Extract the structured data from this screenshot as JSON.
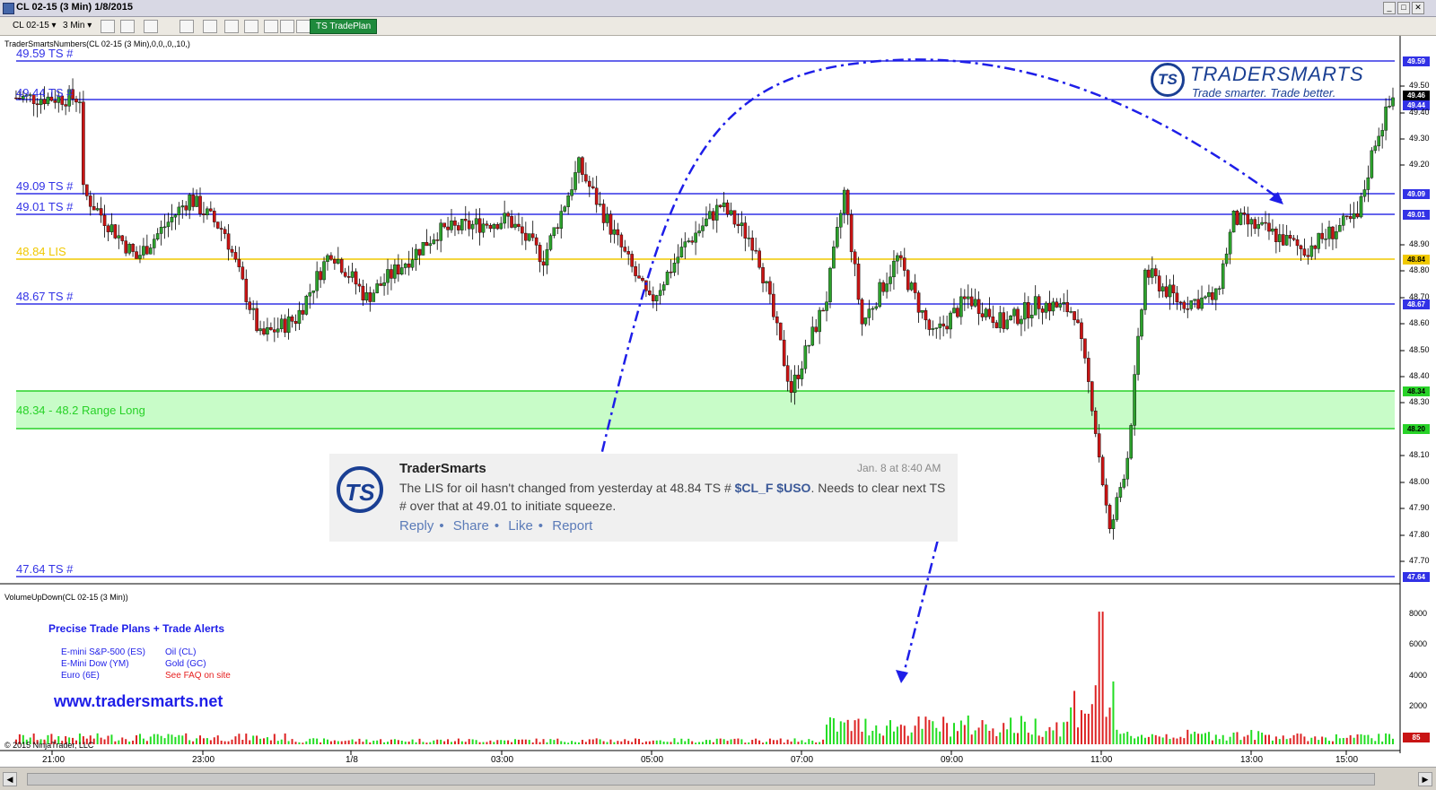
{
  "window": {
    "title": "CL 02-15 (3 Min)  1/8/2015"
  },
  "toolbar": {
    "instrument": "CL 02-15",
    "interval": "3 Min",
    "tradeplan_label": "TS TradePlan"
  },
  "indicator_label": "TraderSmartsNumbers(CL 02-15 (3 Min),0,0,,0,,10,)",
  "volume_label": "VolumeUpDown(CL 02-15 (3 Min))",
  "levels": [
    {
      "label": "49.59 TS #",
      "value": 49.59,
      "tag": "49.59",
      "color": "#3232e6"
    },
    {
      "label": "49.44 TS #",
      "value": 49.44,
      "tag": "49.44",
      "color": "#3232e6"
    },
    {
      "label": "49.09 TS #",
      "value": 49.09,
      "tag": "49.09",
      "color": "#3232e6"
    },
    {
      "label": "49.01 TS #",
      "value": 49.01,
      "tag": "49.01",
      "color": "#3232e6"
    },
    {
      "label": "48.84 LIS",
      "value": 48.84,
      "tag": "48.84",
      "color": "#f0c800"
    },
    {
      "label": "48.67 TS #",
      "value": 48.67,
      "tag": "48.67",
      "color": "#3232e6"
    },
    {
      "label": "47.64 TS #",
      "value": 47.64,
      "tag": "47.64",
      "color": "#3232e6"
    }
  ],
  "range_zone": {
    "label": "48.34 - 48.2 Range Long",
    "top": 48.34,
    "bottom": 48.2,
    "tag_top": "48.34",
    "tag_bottom": "48.20",
    "color": "#28d228"
  },
  "last_price": {
    "value": 49.46,
    "tag": "49.46"
  },
  "price_axis": {
    "ticks": [
      "49.50",
      "49.40",
      "49.30",
      "49.20",
      "48.90",
      "48.80",
      "48.70",
      "48.60",
      "48.50",
      "48.40",
      "48.30",
      "48.10",
      "48.00",
      "47.90",
      "47.80",
      "47.70"
    ]
  },
  "volume_axis": {
    "ticks": [
      "8000",
      "6000",
      "4000",
      "2000"
    ],
    "last_volume_tag": "85"
  },
  "time_axis": {
    "ticks": [
      "21:00",
      "23:00",
      "1/8",
      "03:00",
      "05:00",
      "07:00",
      "09:00",
      "11:00",
      "13:00",
      "15:00"
    ]
  },
  "logo": {
    "mark": "TS",
    "name": "TRADERSMARTS",
    "tagline": "Trade smarter. Trade better."
  },
  "post": {
    "author": "TraderSmarts",
    "avatar": "TS",
    "time": "Jan. 8 at 8:40 AM",
    "text_before": "The LIS for oil hasn't changed from yesterday at 48.84 TS # ",
    "tickers": "$CL_F $USO",
    "text_after": ". Needs to clear next TS # over that at 49.01 to initiate squeeze.",
    "actions": [
      "Reply",
      "Share",
      "Like",
      "Report"
    ]
  },
  "promo": {
    "title": "Precise Trade Plans + Trade Alerts",
    "items_left": [
      "E-mini S&P-500 (ES)",
      "E-Mini Dow (YM)",
      "Euro (6E)"
    ],
    "items_right": [
      "Oil (CL)",
      "Gold (GC)",
      "See FAQ on site"
    ],
    "faq_color": "#e62020",
    "site": "www.tradersmarts.net"
  },
  "copyright": "© 2015 NinjaTrader, LLC",
  "colors": {
    "up_candle": "#2ca02c",
    "down_candle": "#c81414",
    "annotation_arrow": "#1e1ee8"
  },
  "chart_data": {
    "type": "candlestick",
    "instrument": "CL 02-15",
    "interval": "3 Min",
    "ylim": [
      47.64,
      49.6
    ],
    "close_path": [
      [
        "21:00",
        49.1
      ],
      [
        "21:45",
        48.85
      ],
      [
        "22:30",
        49.08
      ],
      [
        "23:00",
        48.95
      ],
      [
        "23:30",
        48.55
      ],
      [
        "00:00",
        48.62
      ],
      [
        "00:30",
        48.88
      ],
      [
        "01:00",
        48.7
      ],
      [
        "02:00",
        48.95
      ],
      [
        "03:00",
        49.0
      ],
      [
        "03:30",
        48.85
      ],
      [
        "04:00",
        49.2
      ],
      [
        "05:00",
        48.68
      ],
      [
        "05:30",
        48.9
      ],
      [
        "06:00",
        49.05
      ],
      [
        "06:30",
        48.9
      ],
      [
        "07:00",
        48.35
      ],
      [
        "07:30",
        48.7
      ],
      [
        "07:45",
        49.1
      ],
      [
        "08:00",
        48.6
      ],
      [
        "08:30",
        48.85
      ],
      [
        "09:00",
        48.55
      ],
      [
        "09:30",
        48.7
      ],
      [
        "10:00",
        48.6
      ],
      [
        "10:30",
        48.68
      ],
      [
        "11:00",
        48.65
      ],
      [
        "11:15",
        48.3
      ],
      [
        "11:30",
        47.8
      ],
      [
        "11:45",
        48.1
      ],
      [
        "12:00",
        48.8
      ],
      [
        "12:30",
        48.68
      ],
      [
        "13:00",
        48.7
      ],
      [
        "13:15",
        49.0
      ],
      [
        "13:45",
        48.95
      ],
      [
        "14:15",
        48.88
      ],
      [
        "14:45",
        48.97
      ],
      [
        "15:00",
        49.0
      ],
      [
        "15:15",
        49.3
      ],
      [
        "15:30",
        49.46
      ]
    ],
    "volume_axis_ticks": [
      2000,
      4000,
      6000,
      8000
    ]
  }
}
